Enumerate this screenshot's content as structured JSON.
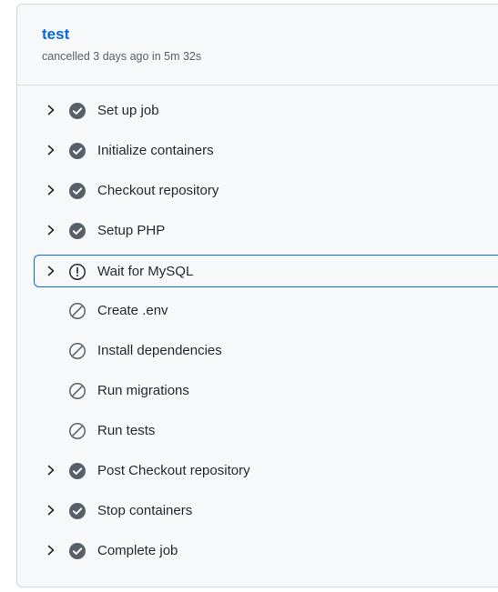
{
  "job": {
    "title": "test",
    "meta": "cancelled 3 days ago in 5m 32s"
  },
  "colors": {
    "success_icon": "#57606a",
    "accent": "#0969da",
    "warning_icon": "#24292f",
    "skipped_icon": "#57606a"
  },
  "steps": [
    {
      "label": "Set up job",
      "status": "success",
      "icon": "check-circle-icon",
      "expandable": true
    },
    {
      "label": "Initialize containers",
      "status": "success",
      "icon": "check-circle-icon",
      "expandable": true
    },
    {
      "label": "Checkout repository",
      "status": "success",
      "icon": "check-circle-icon",
      "expandable": true
    },
    {
      "label": "Setup PHP",
      "status": "success",
      "icon": "check-circle-icon",
      "expandable": true
    },
    {
      "label": "Wait for MySQL",
      "status": "cancelled",
      "icon": "alert-circle-icon",
      "expandable": true,
      "focused": true
    },
    {
      "label": "Create .env",
      "status": "skipped",
      "icon": "skip-circle-icon",
      "expandable": false
    },
    {
      "label": "Install dependencies",
      "status": "skipped",
      "icon": "skip-circle-icon",
      "expandable": false
    },
    {
      "label": "Run migrations",
      "status": "skipped",
      "icon": "skip-circle-icon",
      "expandable": false
    },
    {
      "label": "Run tests",
      "status": "skipped",
      "icon": "skip-circle-icon",
      "expandable": false
    },
    {
      "label": "Post Checkout repository",
      "status": "success",
      "icon": "check-circle-icon",
      "expandable": true
    },
    {
      "label": "Stop containers",
      "status": "success",
      "icon": "check-circle-icon",
      "expandable": true
    },
    {
      "label": "Complete job",
      "status": "success",
      "icon": "check-circle-icon",
      "expandable": true
    }
  ]
}
